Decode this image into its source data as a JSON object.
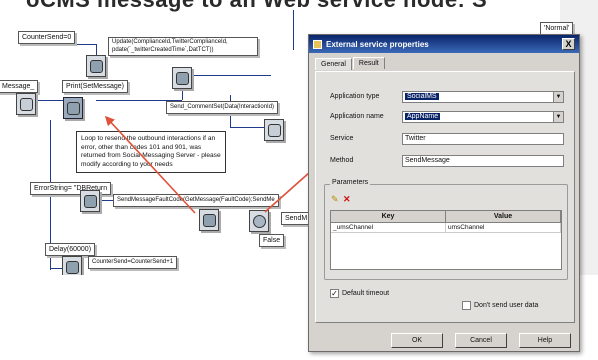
{
  "header_text": "oCMS message to an Web service node: S",
  "workflow": {
    "nodes": {
      "counter_send": "CounterSend=0",
      "update": "Update(ComplianceId,TwitterComplianceId,\npdate(`_twitterCreatedTime`,DatTCT))",
      "message": "Message_",
      "print": "Print(SetMessage)",
      "send_comment": "Send_CommentSet(Data(InteractionId)",
      "error_string": "ErrorString= \"DBReturn",
      "send_message_fault": "SendMessageFaultCode(GetMessage(FaultCode);SendMe",
      "send_m": "SendM",
      "false_label": "False",
      "delay": "Delay(60000)",
      "counter_send2": "CounterSend=CounterSend+1",
      "normal_badge": "'Normal'"
    },
    "balloon": "Loop to resend the outbound interactions if an error, other than codes 101 and 901, was returned from Social Messaging Server - please modify according to your needs"
  },
  "dialog": {
    "title": "External service properties",
    "close_label": "X",
    "tabs": [
      {
        "label": "General",
        "active": true
      },
      {
        "label": "Result",
        "active": false
      }
    ],
    "fields": {
      "application_type_label": "Application type",
      "application_type_value": "SocialMS",
      "application_name_label": "Application name",
      "application_name_value": "AppName",
      "service_label": "Service",
      "service_value": "Twitter",
      "method_label": "Method",
      "method_value": "SendMessage"
    },
    "parameters": {
      "group_label": "Parameters",
      "columns": [
        "Key",
        "Value"
      ],
      "rows": [
        {
          "key": "_umsChannel",
          "value": "umsChannel"
        }
      ]
    },
    "default_timeout": {
      "label": "Default timeout",
      "checked": true
    },
    "dont_send_user_data": {
      "label": "Don't send user data",
      "checked": false
    },
    "buttons": {
      "ok": "OK",
      "cancel": "Cancel",
      "help": "Help"
    }
  },
  "colors": {
    "title_bar": "#0a246a",
    "connector": "#1f3a8a",
    "annotation_arrow": "#e0523a",
    "dialog_bg": "#d6d3ce"
  }
}
